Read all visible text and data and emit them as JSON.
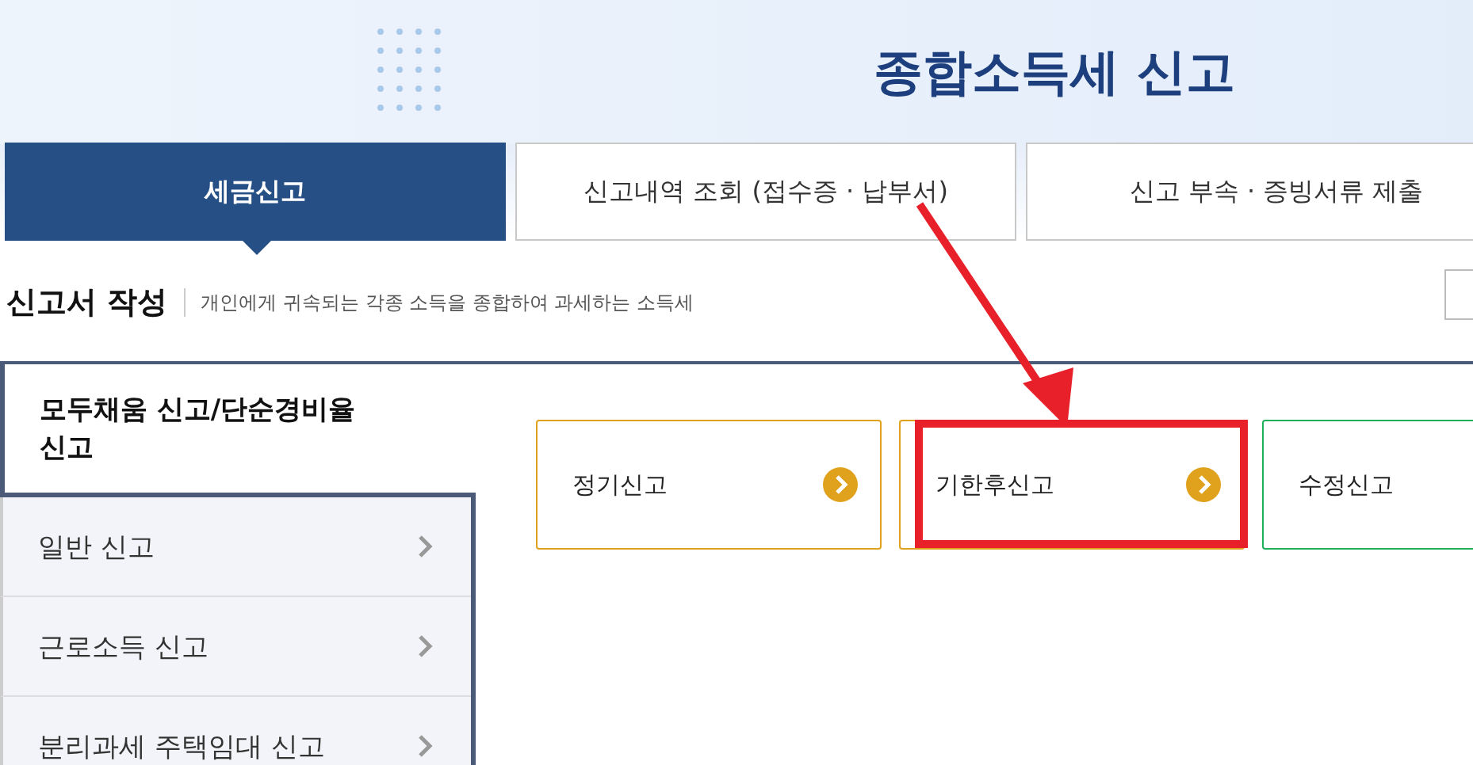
{
  "page_title": "종합소득세 신고",
  "tabs": [
    {
      "label": "세금신고",
      "selected": true
    },
    {
      "label": "신고내역 조회 (접수증 · 납부서)",
      "selected": false
    },
    {
      "label": "신고 부속 · 증빙서류 제출",
      "selected": false
    }
  ],
  "section": {
    "title": "신고서 작성",
    "subtitle": "개인에게 귀속되는 각종 소득을 종합하여 과세하는 소득세"
  },
  "sidebar": {
    "items": [
      {
        "label": "모두채움 신고/단순경비율 신고",
        "selected": true
      },
      {
        "label": "일반 신고",
        "selected": false
      },
      {
        "label": "근로소득 신고",
        "selected": false
      },
      {
        "label": "분리과세 주택임대 신고",
        "selected": false
      }
    ]
  },
  "cards": [
    {
      "label": "정기신고",
      "color": "#e0a21c",
      "highlighted": false
    },
    {
      "label": "기한후신고",
      "color": "#e0a21c",
      "highlighted": true
    },
    {
      "label": "수정신고",
      "color": "#1fb05a",
      "highlighted": false
    }
  ]
}
